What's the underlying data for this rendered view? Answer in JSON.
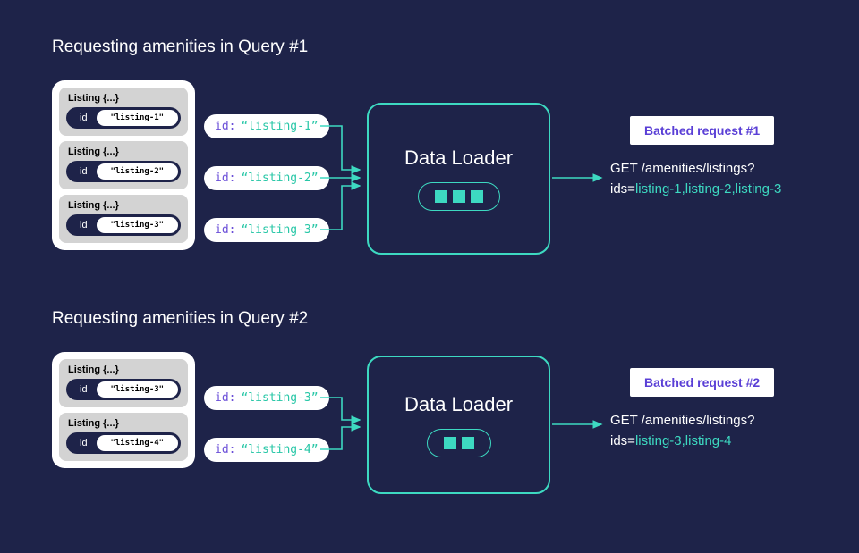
{
  "section1": {
    "title": "Requesting amenities in Query #1",
    "listings": [
      {
        "header": "Listing {...}",
        "idLabel": "id",
        "idValue": "\"listing-1\""
      },
      {
        "header": "Listing {...}",
        "idLabel": "id",
        "idValue": "\"listing-2\""
      },
      {
        "header": "Listing {...}",
        "idLabel": "id",
        "idValue": "\"listing-3\""
      }
    ],
    "pills": [
      {
        "key": "id:",
        "val": "“listing-1”"
      },
      {
        "key": "id:",
        "val": "“listing-2”"
      },
      {
        "key": "id:",
        "val": "“listing-3”"
      }
    ],
    "loader": {
      "title": "Data Loader",
      "count": 3
    },
    "batched": {
      "label": "Batched request #1"
    },
    "request": {
      "line1": "GET /amenities/listings?",
      "eq": "ids=",
      "ids": "listing-1,listing-2,listing-3"
    }
  },
  "section2": {
    "title": "Requesting amenities in Query #2",
    "listings": [
      {
        "header": "Listing {...}",
        "idLabel": "id",
        "idValue": "\"listing-3\""
      },
      {
        "header": "Listing {...}",
        "idLabel": "id",
        "idValue": "\"listing-4\""
      }
    ],
    "pills": [
      {
        "key": "id:",
        "val": "“listing-3”"
      },
      {
        "key": "id:",
        "val": "“listing-4”"
      }
    ],
    "loader": {
      "title": "Data Loader",
      "count": 2
    },
    "batched": {
      "label": "Batched request #2"
    },
    "request": {
      "line1": "GET /amenities/listings?",
      "eq": "ids=",
      "ids": "listing-3,listing-4"
    }
  }
}
